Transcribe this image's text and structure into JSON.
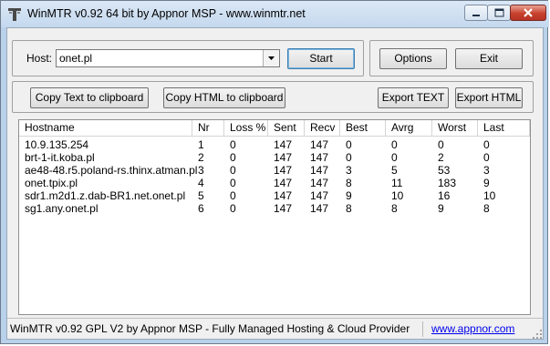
{
  "window": {
    "title": "WinMTR v0.92 64 bit by Appnor MSP - www.winmtr.net"
  },
  "host": {
    "label": "Host:",
    "value": "onet.pl"
  },
  "buttons": {
    "start": "Start",
    "options": "Options",
    "exit": "Exit",
    "copy_text": "Copy Text to clipboard",
    "copy_html": "Copy HTML to clipboard",
    "export_text": "Export TEXT",
    "export_html": "Export HTML"
  },
  "table": {
    "columns": [
      "Hostname",
      "Nr",
      "Loss %",
      "Sent",
      "Recv",
      "Best",
      "Avrg",
      "Worst",
      "Last"
    ],
    "rows": [
      [
        "10.9.135.254",
        "1",
        "0",
        "147",
        "147",
        "0",
        "0",
        "0",
        "0"
      ],
      [
        "brt-1-it.koba.pl",
        "2",
        "0",
        "147",
        "147",
        "0",
        "0",
        "2",
        "0"
      ],
      [
        "ae48-48.r5.poland-rs.thinx.atman.pl",
        "3",
        "0",
        "147",
        "147",
        "3",
        "5",
        "53",
        "3"
      ],
      [
        "onet.tpix.pl",
        "4",
        "0",
        "147",
        "147",
        "8",
        "11",
        "183",
        "9"
      ],
      [
        "sdr1.m2d1.z.dab-BR1.net.onet.pl",
        "5",
        "0",
        "147",
        "147",
        "9",
        "10",
        "16",
        "10"
      ],
      [
        "sg1.any.onet.pl",
        "6",
        "0",
        "147",
        "147",
        "8",
        "8",
        "9",
        "8"
      ]
    ]
  },
  "status": {
    "text": "WinMTR v0.92 GPL V2 by Appnor MSP - Fully Managed Hosting & Cloud Provider",
    "link": "www.appnor.com"
  },
  "icons": {
    "app": "winmtr-app-icon",
    "minimize": "minimize-icon",
    "maximize": "maximize-icon",
    "close": "close-icon",
    "dropdown": "chevron-down-icon",
    "grip": "resize-grip-icon"
  },
  "colors": {
    "title_bar": "#c4d8ee",
    "close_button": "#c7402d",
    "link": "#0000ee"
  }
}
